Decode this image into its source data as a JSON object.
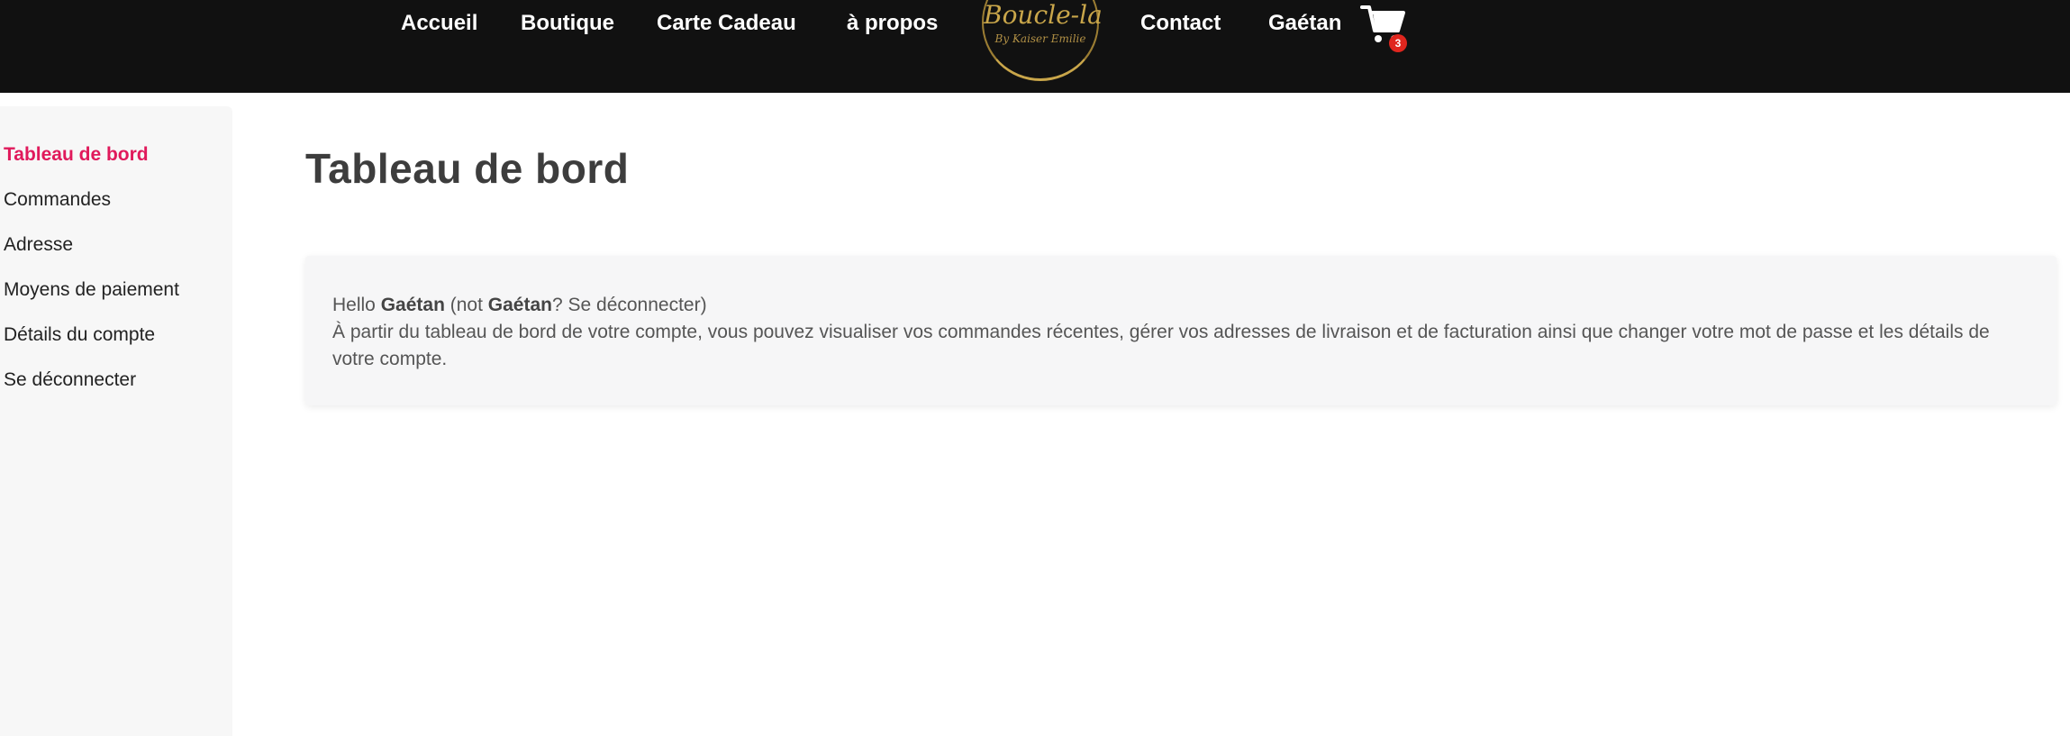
{
  "header": {
    "nav": [
      {
        "label": "Accueil"
      },
      {
        "label": "Boutique"
      },
      {
        "label": "Carte Cadeau"
      },
      {
        "label": "à propos"
      },
      {
        "label": "Contact"
      },
      {
        "label": "Gaétan"
      }
    ],
    "logo": {
      "title": "Boucle-la",
      "subtitle": "By Kaiser Emilie"
    },
    "cart": {
      "icon": "cart-icon",
      "count": "3"
    }
  },
  "sidebar": {
    "items": [
      {
        "label": "Tableau de bord",
        "active": true
      },
      {
        "label": "Commandes"
      },
      {
        "label": "Adresse"
      },
      {
        "label": "Moyens de paiement"
      },
      {
        "label": "Détails du compte"
      },
      {
        "label": "Se déconnecter"
      }
    ]
  },
  "main": {
    "title": "Tableau de bord",
    "greeting": {
      "hello": "Hello",
      "name": "Gaétan",
      "not_open": "(not",
      "not_name": "Gaétan",
      "logout_text": "? Se déconnecter)"
    },
    "description": "À partir du tableau de bord de votre compte, vous pouvez visualiser vos commandes récentes, gérer vos adresses de livraison et de facturation ainsi que changer votre mot de passe et les détails de votre compte."
  },
  "colors": {
    "header_bg": "#111111",
    "accent": "#e0195b",
    "logo_gold": "#c9a64a",
    "badge": "#e0261e"
  }
}
